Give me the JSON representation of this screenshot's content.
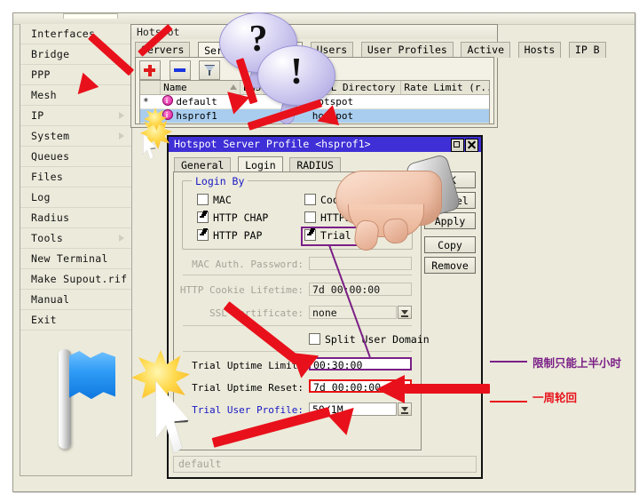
{
  "app": {
    "menu_items": [
      {
        "label": "Interfaces",
        "submenu": false
      },
      {
        "label": "Bridge",
        "submenu": false
      },
      {
        "label": "PPP",
        "submenu": false
      },
      {
        "label": "Mesh",
        "submenu": false
      },
      {
        "label": "IP",
        "submenu": true
      },
      {
        "label": "System",
        "submenu": true
      },
      {
        "label": "Queues",
        "submenu": false
      },
      {
        "label": "Files",
        "submenu": false
      },
      {
        "label": "Log",
        "submenu": false
      },
      {
        "label": "Radius",
        "submenu": false
      },
      {
        "label": "Tools",
        "submenu": true
      },
      {
        "label": "New Terminal",
        "submenu": false
      },
      {
        "label": "Make Supout.rif",
        "submenu": false
      },
      {
        "label": "Manual",
        "submenu": false
      },
      {
        "label": "Exit",
        "submenu": false
      }
    ]
  },
  "hotspot_window": {
    "title": "Hotspot",
    "tabs": [
      {
        "label": "Servers",
        "active": false
      },
      {
        "label": "Server Profiles",
        "active": true
      },
      {
        "label": "Users",
        "active": false
      },
      {
        "label": "User Profiles",
        "active": false
      },
      {
        "label": "Active",
        "active": false
      },
      {
        "label": "Hosts",
        "active": false
      },
      {
        "label": "IP B",
        "active": false
      }
    ],
    "toolbar": {
      "add_label": "+",
      "remove_label": "-",
      "filter_label": "filter"
    },
    "table": {
      "columns": [
        "",
        "Name",
        "DNS Name",
        "HTML Directory",
        "Rate Limit (r..."
      ],
      "rows": [
        {
          "flag": "*",
          "name": "default",
          "dns_name": "",
          "html_directory": "hotspot",
          "rate_limit": "",
          "selected": false
        },
        {
          "flag": "",
          "name": "hsprof1",
          "dns_name": "",
          "html_directory": "hotspot",
          "rate_limit": "",
          "selected": true
        }
      ]
    }
  },
  "dialog": {
    "title": "Hotspot Server Profile <hsprof1>",
    "tabs": [
      {
        "label": "General",
        "active": false
      },
      {
        "label": "Login",
        "active": true
      },
      {
        "label": "RADIUS",
        "active": false
      }
    ],
    "group_login_by": "Login By",
    "checkboxes": [
      {
        "label": "MAC",
        "checked": false
      },
      {
        "label": "HTTP CHAP",
        "checked": true
      },
      {
        "label": "HTTP PAP",
        "checked": true
      },
      {
        "label": "Cookie",
        "checked": false
      },
      {
        "label": "HTTPS",
        "checked": false
      },
      {
        "label": "Trial",
        "checked": true,
        "highlight": "#7a1f86"
      }
    ],
    "fields": [
      {
        "label": "MAC Auth. Password:",
        "value": "",
        "disabled": true
      },
      {
        "label": "HTTP Cookie Lifetime:",
        "value": "7d 00:00:00",
        "disabled": true
      },
      {
        "label": "SSL Certificate:",
        "value": "none",
        "disabled": true,
        "dropdown": true
      },
      {
        "label": "Trial Uptime Limit:",
        "value": "00:30:00",
        "disabled": false,
        "highlight": "#7a1f86"
      },
      {
        "label": "Trial Uptime Reset:",
        "value": "7d 00:00:00",
        "disabled": false,
        "highlight": "#e81212"
      },
      {
        "label": "Trial User Profile:",
        "value": "50/1M",
        "disabled": false,
        "dropdown": true,
        "blue_label": true
      }
    ],
    "split_user_domain": {
      "label": "Split User Domain",
      "checked": false
    },
    "buttons": [
      "OK",
      "Cancel",
      "Apply",
      "Copy",
      "Remove"
    ],
    "status": "default"
  },
  "annotations": {
    "bubbles": [
      {
        "glyph": "?"
      },
      {
        "glyph": "!"
      }
    ],
    "callouts": [
      {
        "text": "限制只能上半小时",
        "color": "#7a1f86"
      },
      {
        "text": "一周轮回",
        "color": "#e81212"
      }
    ]
  },
  "colors": {
    "accent_red": "#e8111b",
    "accent_purple": "#7a1f86",
    "dialog_title_bg": "#3e2fd6",
    "selection_blue": "#a9cdef",
    "window_bg": "#eceadb"
  }
}
